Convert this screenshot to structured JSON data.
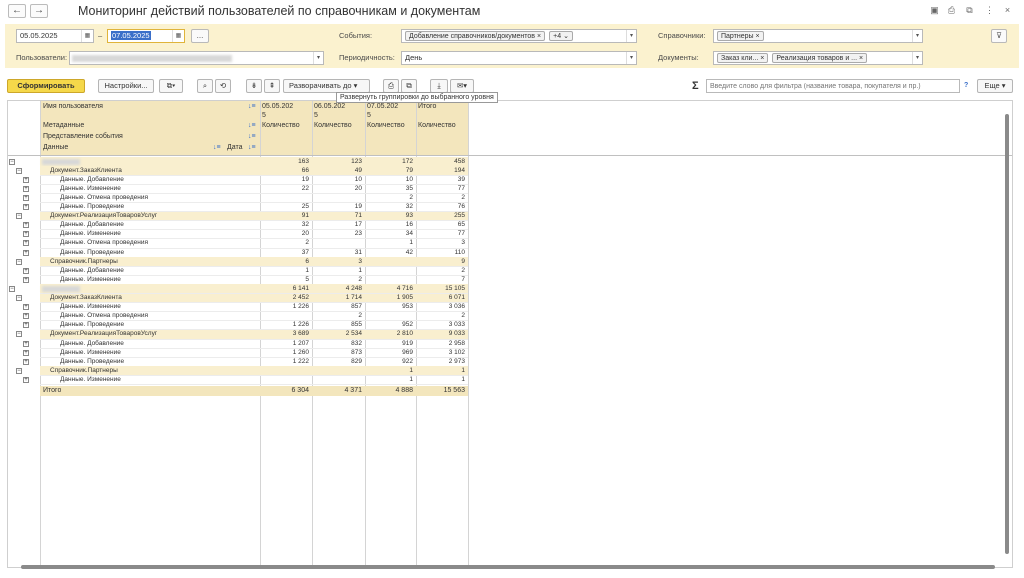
{
  "window": {
    "title": "Мониторинг действий пользователей по справочникам и документам",
    "back": "←",
    "forward": "→",
    "icons": [
      "save-icon",
      "print-icon",
      "preview-icon",
      "more-icon",
      "close-icon"
    ],
    "icon_glyphs": [
      "▣",
      "⎙",
      "⧉",
      "⋮",
      "×"
    ]
  },
  "filters": {
    "date_from": "05.05.2025",
    "date_sep": "–",
    "date_to": "07.05.2025",
    "date_more": "...",
    "users_label": "Пользователи:",
    "events_label": "События:",
    "events_tag": "Добавление справочников/документов",
    "events_more": "+4",
    "period_label": "Периодичность:",
    "period_value": "День",
    "catalogs_label": "Справочники:",
    "catalogs_tag": "Партнеры",
    "documents_label": "Документы:",
    "documents_tags": [
      "Заказ кли...",
      "Реализация товаров и ..."
    ]
  },
  "toolbar": {
    "generate": "Сформировать",
    "settings": "Настройки...",
    "expand_to": "Разворачивать до",
    "search_placeholder": "Введите слово для фильтра (название товара, покупателя и пр.)",
    "help": "?",
    "more": "Еще",
    "sigma": "Σ",
    "tooltip": "Развернуть группировки до выбранного уровня"
  },
  "report": {
    "header_rows": {
      "user_name": "Имя пользователя",
      "metadata": "Метаданные",
      "event": "Представление события",
      "data": "Данные",
      "date": "Дата"
    },
    "columns": [
      {
        "title": "05.05.202",
        "sub": "5",
        "measure": "Количество"
      },
      {
        "title": "06.05.202",
        "sub": "5",
        "measure": "Количество"
      },
      {
        "title": "07.05.202",
        "sub": "5",
        "measure": "Количество"
      },
      {
        "title": "Итого",
        "sub": "",
        "measure": "Количество"
      }
    ],
    "rows": [
      {
        "label": "",
        "level": 0,
        "v": [
          "163",
          "123",
          "172",
          "458"
        ]
      },
      {
        "label": "Документ.ЗаказКлиента",
        "level": 1,
        "v": [
          "66",
          "49",
          "79",
          "194"
        ]
      },
      {
        "label": "Данные. Добавление",
        "level": 2,
        "v": [
          "19",
          "10",
          "10",
          "39"
        ]
      },
      {
        "label": "Данные. Изменение",
        "level": 2,
        "v": [
          "22",
          "20",
          "35",
          "77"
        ]
      },
      {
        "label": "Данные. Отмена проведения",
        "level": 2,
        "v": [
          "",
          "",
          "2",
          "2"
        ]
      },
      {
        "label": "Данные. Проведение",
        "level": 2,
        "v": [
          "25",
          "19",
          "32",
          "76"
        ]
      },
      {
        "label": "Документ.РеализацияТоваровУслуг",
        "level": 1,
        "v": [
          "91",
          "71",
          "93",
          "255"
        ]
      },
      {
        "label": "Данные. Добавление",
        "level": 2,
        "v": [
          "32",
          "17",
          "16",
          "65"
        ]
      },
      {
        "label": "Данные. Изменение",
        "level": 2,
        "v": [
          "20",
          "23",
          "34",
          "77"
        ]
      },
      {
        "label": "Данные. Отмена проведения",
        "level": 2,
        "v": [
          "2",
          "",
          "1",
          "3"
        ]
      },
      {
        "label": "Данные. Проведение",
        "level": 2,
        "v": [
          "37",
          "31",
          "42",
          "110"
        ]
      },
      {
        "label": "Справочник.Партнеры",
        "level": 1,
        "v": [
          "6",
          "3",
          "",
          "9"
        ]
      },
      {
        "label": "Данные. Добавление",
        "level": 2,
        "v": [
          "1",
          "1",
          "",
          "2"
        ]
      },
      {
        "label": "Данные. Изменение",
        "level": 2,
        "v": [
          "5",
          "2",
          "",
          "7"
        ]
      },
      {
        "label": "",
        "level": 0,
        "v": [
          "6 141",
          "4 248",
          "4 716",
          "15 105"
        ]
      },
      {
        "label": "Документ.ЗаказКлиента",
        "level": 1,
        "v": [
          "2 452",
          "1 714",
          "1 905",
          "6 071"
        ]
      },
      {
        "label": "Данные. Изменение",
        "level": 2,
        "v": [
          "1 226",
          "857",
          "953",
          "3 036"
        ]
      },
      {
        "label": "Данные. Отмена проведения",
        "level": 2,
        "v": [
          "",
          "2",
          "",
          "2"
        ]
      },
      {
        "label": "Данные. Проведение",
        "level": 2,
        "v": [
          "1 226",
          "855",
          "952",
          "3 033"
        ]
      },
      {
        "label": "Документ.РеализацияТоваровУслуг",
        "level": 1,
        "v": [
          "3 689",
          "2 534",
          "2 810",
          "9 033"
        ]
      },
      {
        "label": "Данные. Добавление",
        "level": 2,
        "v": [
          "1 207",
          "832",
          "919",
          "2 958"
        ]
      },
      {
        "label": "Данные. Изменение",
        "level": 2,
        "v": [
          "1 260",
          "873",
          "969",
          "3 102"
        ]
      },
      {
        "label": "Данные. Проведение",
        "level": 2,
        "v": [
          "1 222",
          "829",
          "922",
          "2 973"
        ]
      },
      {
        "label": "Справочник.Партнеры",
        "level": 1,
        "v": [
          "",
          "",
          "1",
          "1"
        ]
      },
      {
        "label": "Данные. Изменение",
        "level": 2,
        "v": [
          "",
          "",
          "1",
          "1"
        ]
      }
    ],
    "total": {
      "label": "Итого",
      "v": [
        "6 304",
        "4 371",
        "4 888",
        "15 563"
      ]
    },
    "colors": {
      "group_bg": "#f9efcf",
      "header_bg": "#f3e6bd",
      "accent": "#f5d84a"
    }
  }
}
